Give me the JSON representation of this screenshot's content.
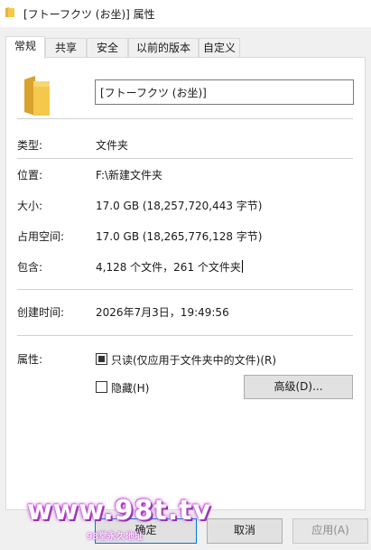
{
  "window": {
    "title": "[フトーフクツ (お坐)] 属性",
    "title_icon": "folder-icon"
  },
  "tabs": [
    {
      "label": "常规",
      "active": true
    },
    {
      "label": "共享",
      "active": false
    },
    {
      "label": "安全",
      "active": false
    },
    {
      "label": "以前的版本",
      "active": false
    },
    {
      "label": "自定义",
      "active": false
    }
  ],
  "general": {
    "folder_icon": "folder-icon",
    "name_value": "[フトーフクツ (お坐)]",
    "type_label": "类型:",
    "type_value": "文件夹",
    "location_label": "位置:",
    "location_value": "F:\\新建文件夹",
    "size_label": "大小:",
    "size_value": "17.0 GB (18,257,720,443 字节)",
    "size_on_disk_label": "占用空间:",
    "size_on_disk_value": "17.0 GB (18,265,776,128 字节)",
    "contains_label": "包含:",
    "contains_value": "4,128 个文件，261 个文件夹",
    "created_label": "创建时间:",
    "created_value": "2026年7月3日，19:49:56",
    "attributes_label": "属性:",
    "readonly_label": "只读(仅应用于文件夹中的文件)(R)",
    "readonly_checked": true,
    "hidden_label": "隐藏(H)",
    "hidden_checked": false,
    "advanced_label": "高级(D)..."
  },
  "buttons": {
    "ok_label": "确定",
    "cancel_label": "取消",
    "apply_label": "应用(A)"
  },
  "watermark": {
    "main_text": "www.98t.tv",
    "sub_text": "98堂永久地址"
  },
  "colors": {
    "accent": "#0078d7",
    "folder": "#f5c84c",
    "watermark_glow": "#c44bd6"
  }
}
